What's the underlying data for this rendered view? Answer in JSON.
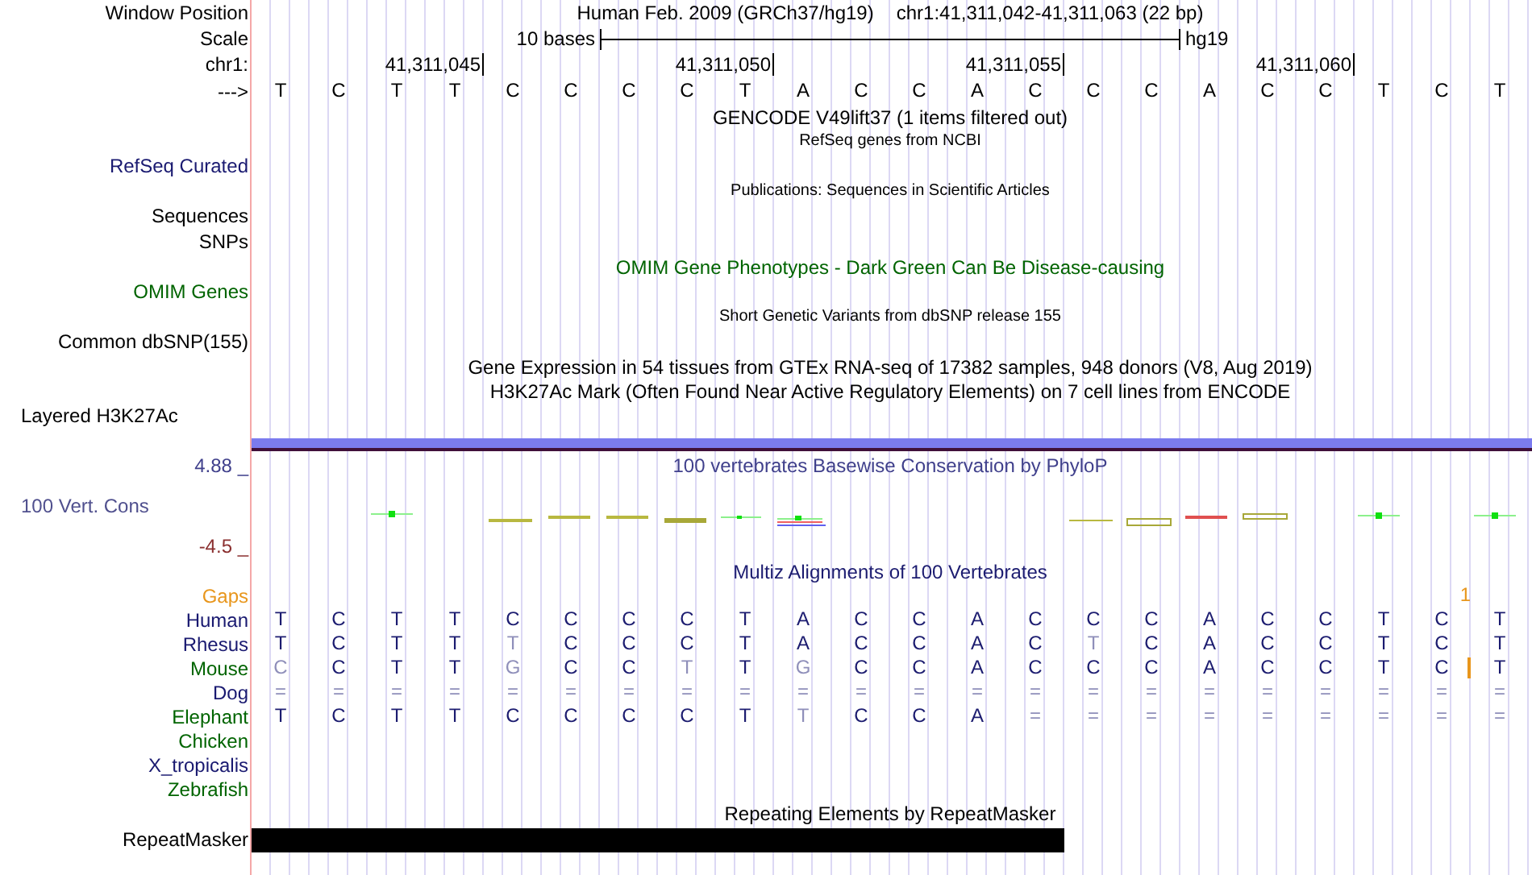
{
  "position_row": {
    "label": "Window Position",
    "assembly": "Human Feb. 2009 (GRCh37/hg19)",
    "range": "chr1:41,311,042-41,311,063 (22 bp)"
  },
  "scale_row": {
    "label": "Scale",
    "span": "10 bases",
    "assembly": "hg19"
  },
  "ruler": {
    "label": "chr1:",
    "ticks": [
      "41,311,045",
      "41,311,050",
      "41,311,055",
      "41,311,060"
    ]
  },
  "sequence": {
    "label": "--->",
    "bases": [
      "T",
      "C",
      "T",
      "T",
      "C",
      "C",
      "C",
      "C",
      "T",
      "A",
      "C",
      "C",
      "A",
      "C",
      "C",
      "C",
      "A",
      "C",
      "C",
      "T",
      "C",
      "T"
    ]
  },
  "tracks": [
    {
      "kind": "title",
      "text": "GENCODE V49lift37 (1 items filtered out)",
      "color": "#000000"
    },
    {
      "kind": "small-title",
      "text": "RefSeq genes from NCBI"
    },
    {
      "kind": "label",
      "text": "RefSeq Curated",
      "color": "#191970"
    },
    {
      "kind": "small-title",
      "text": "Publications: Sequences in Scientific Articles"
    },
    {
      "kind": "label",
      "text": "Sequences",
      "color": "#000000"
    },
    {
      "kind": "label",
      "text": "SNPs",
      "color": "#000000"
    },
    {
      "kind": "title",
      "text": "OMIM Gene Phenotypes - Dark Green Can Be Disease-causing",
      "color": "#006400"
    },
    {
      "kind": "label",
      "text": "OMIM Genes",
      "color": "#006400"
    },
    {
      "kind": "small-title",
      "text": "Short Genetic Variants from dbSNP release 155"
    },
    {
      "kind": "label",
      "text": "Common dbSNP(155)",
      "color": "#000000"
    },
    {
      "kind": "title",
      "text": "Gene Expression in 54 tissues from GTEx RNA-seq of 17382 samples, 948 donors (V8, Aug 2019)",
      "color": "#000000"
    },
    {
      "kind": "title",
      "text": "H3K27Ac Mark (Often Found Near Active Regulatory Elements) on 7 cell lines from ENCODE",
      "color": "#000000"
    },
    {
      "kind": "left-label",
      "text": "Layered H3K27Ac"
    },
    {
      "kind": "bar"
    }
  ],
  "conservation": {
    "max": "4.88 _",
    "title": "100 vertebrates Basewise Conservation by PhyloP",
    "label": "100 Vert. Cons",
    "min": "-4.5 _"
  },
  "multiz": {
    "title": "Multiz Alignments of 100 Vertebrates",
    "gaps": {
      "label": "Gaps",
      "count": "1"
    },
    "species": [
      {
        "name": "Human",
        "color": "#191970",
        "bases": [
          "T",
          "C",
          "T",
          "T",
          "C",
          "C",
          "C",
          "C",
          "T",
          "A",
          "C",
          "C",
          "A",
          "C",
          "C",
          "C",
          "A",
          "C",
          "C",
          "T",
          "C",
          "T"
        ],
        "faded": [
          false,
          false,
          false,
          false,
          false,
          false,
          false,
          false,
          false,
          false,
          false,
          false,
          false,
          false,
          false,
          false,
          false,
          false,
          false,
          false,
          false,
          false
        ]
      },
      {
        "name": "Rhesus",
        "color": "#191970",
        "bases": [
          "T",
          "C",
          "T",
          "T",
          "T",
          "C",
          "C",
          "C",
          "T",
          "A",
          "C",
          "C",
          "A",
          "C",
          "T",
          "C",
          "A",
          "C",
          "C",
          "T",
          "C",
          "T"
        ],
        "faded": [
          false,
          false,
          false,
          false,
          true,
          false,
          false,
          false,
          false,
          false,
          false,
          false,
          false,
          false,
          true,
          false,
          false,
          false,
          false,
          false,
          false,
          false
        ]
      },
      {
        "name": "Mouse",
        "color": "#006400",
        "insertion": true,
        "bases": [
          "C",
          "C",
          "T",
          "T",
          "G",
          "C",
          "C",
          "T",
          "T",
          "G",
          "C",
          "C",
          "A",
          "C",
          "C",
          "C",
          "A",
          "C",
          "C",
          "T",
          "C",
          "T"
        ],
        "faded": [
          true,
          false,
          false,
          false,
          true,
          false,
          false,
          true,
          false,
          true,
          false,
          false,
          false,
          false,
          false,
          false,
          false,
          false,
          false,
          false,
          false,
          false
        ]
      },
      {
        "name": "Dog",
        "color": "#191970",
        "bases": [
          "=",
          "=",
          "=",
          "=",
          "=",
          "=",
          "=",
          "=",
          "=",
          "=",
          "=",
          "=",
          "=",
          "=",
          "=",
          "=",
          "=",
          "=",
          "=",
          "=",
          "=",
          "="
        ],
        "faded": [
          true,
          true,
          true,
          true,
          true,
          true,
          true,
          true,
          true,
          true,
          true,
          true,
          true,
          true,
          true,
          true,
          true,
          true,
          true,
          true,
          true,
          true
        ]
      },
      {
        "name": "Elephant",
        "color": "#006400",
        "bases": [
          "T",
          "C",
          "T",
          "T",
          "C",
          "C",
          "C",
          "C",
          "T",
          "T",
          "C",
          "C",
          "A",
          "=",
          "=",
          "=",
          "=",
          "=",
          "=",
          "=",
          "=",
          "="
        ],
        "faded": [
          false,
          false,
          false,
          false,
          false,
          false,
          false,
          false,
          false,
          true,
          false,
          false,
          false,
          true,
          true,
          true,
          true,
          true,
          true,
          true,
          true,
          true
        ]
      },
      {
        "name": "Chicken",
        "color": "#006400"
      },
      {
        "name": "X_tropicalis",
        "color": "#191970"
      },
      {
        "name": "Zebrafish",
        "color": "#006400"
      }
    ]
  },
  "repeatmasker": {
    "title": "Repeating Elements by RepeatMasker",
    "label": "RepeatMasker"
  }
}
